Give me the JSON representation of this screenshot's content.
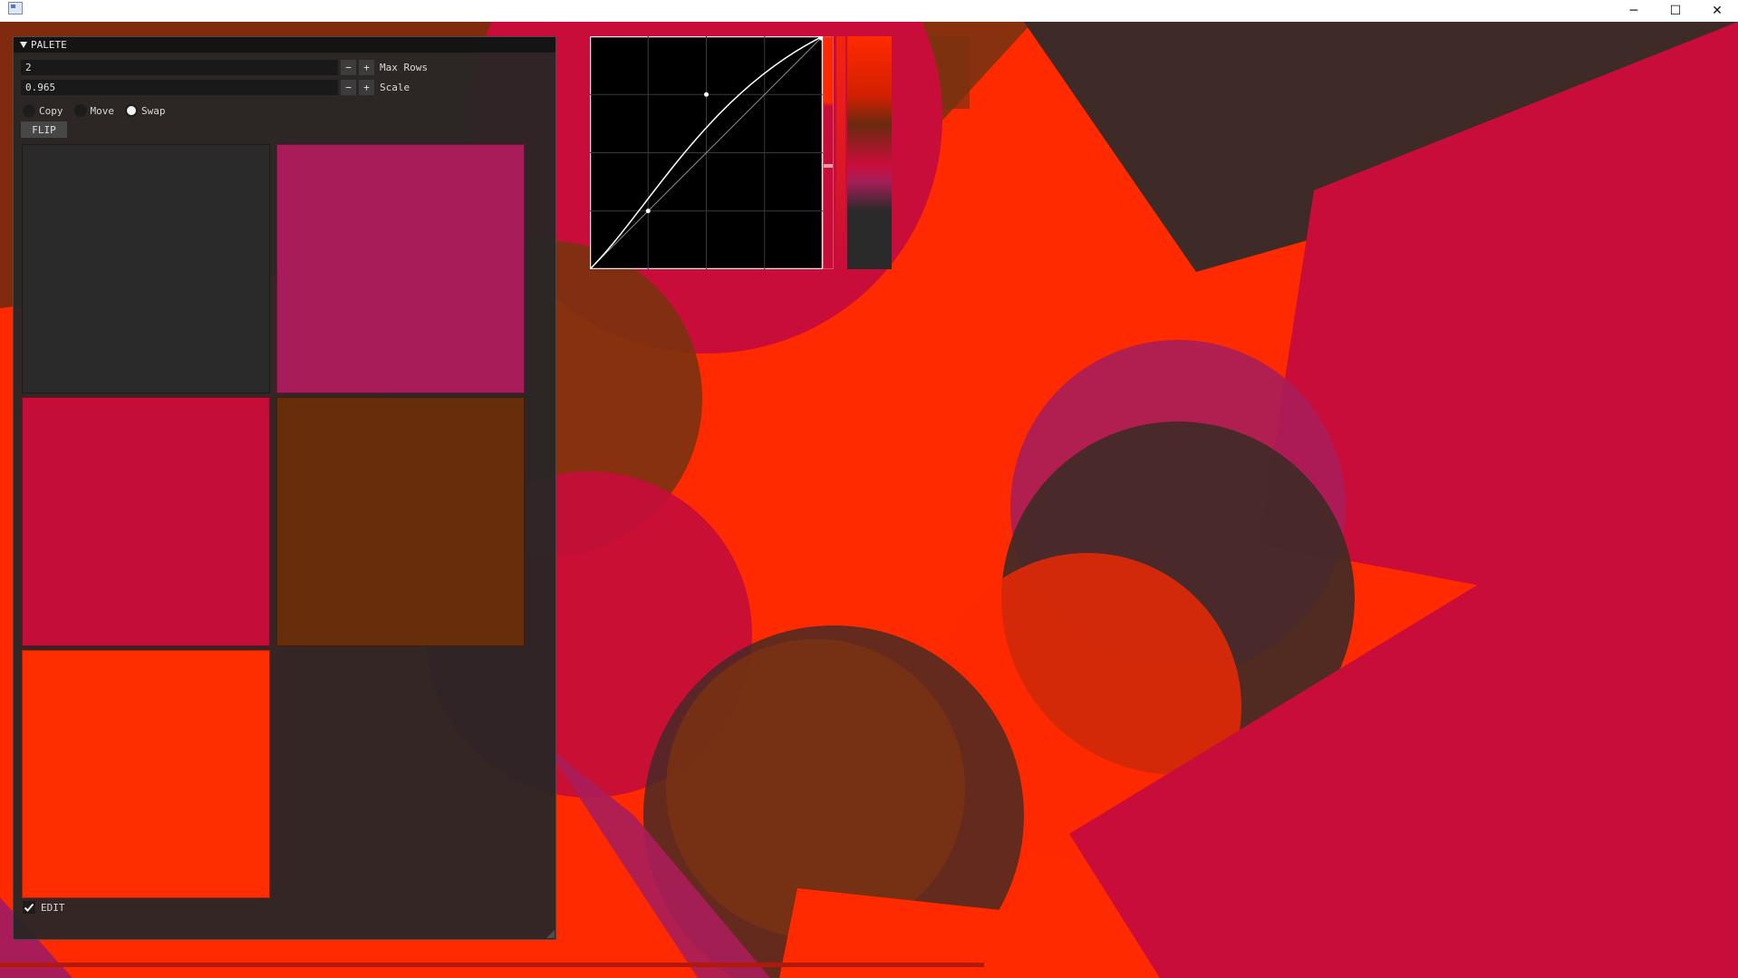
{
  "panel": {
    "title": "PALETE",
    "max_rows": {
      "value": "2",
      "label": "Max Rows",
      "minus": "−",
      "plus": "+"
    },
    "scale": {
      "value": "0.965",
      "label": "Scale",
      "minus": "−",
      "plus": "+"
    },
    "modes": [
      {
        "label": "Copy",
        "selected": false
      },
      {
        "label": "Move",
        "selected": false
      },
      {
        "label": "Swap",
        "selected": true
      }
    ],
    "flip_label": "FLIP",
    "swatches": [
      "#2a2a2a",
      "#a81d59",
      "#c40d38",
      "#672e0b",
      "#ff2e00"
    ],
    "edit_label": "EDIT",
    "edit_checked": true
  },
  "curve": {
    "control_points": [
      [
        0,
        0
      ],
      [
        0.25,
        0.25
      ],
      [
        0.5,
        0.75
      ],
      [
        1,
        1
      ]
    ],
    "grid_divisions": 4
  },
  "colors": {
    "background": "#ff2a00",
    "crimson": "#c90d3a",
    "magenta": "#a81d59",
    "brown": "#672e0b",
    "dark": "#2a2a2a"
  },
  "window": {
    "minimize": "─",
    "maximize": "☐",
    "close": "✕"
  },
  "icons": {
    "window": "app-window-icon",
    "collapse": "triangle-down-icon",
    "check": "checkmark-icon"
  }
}
